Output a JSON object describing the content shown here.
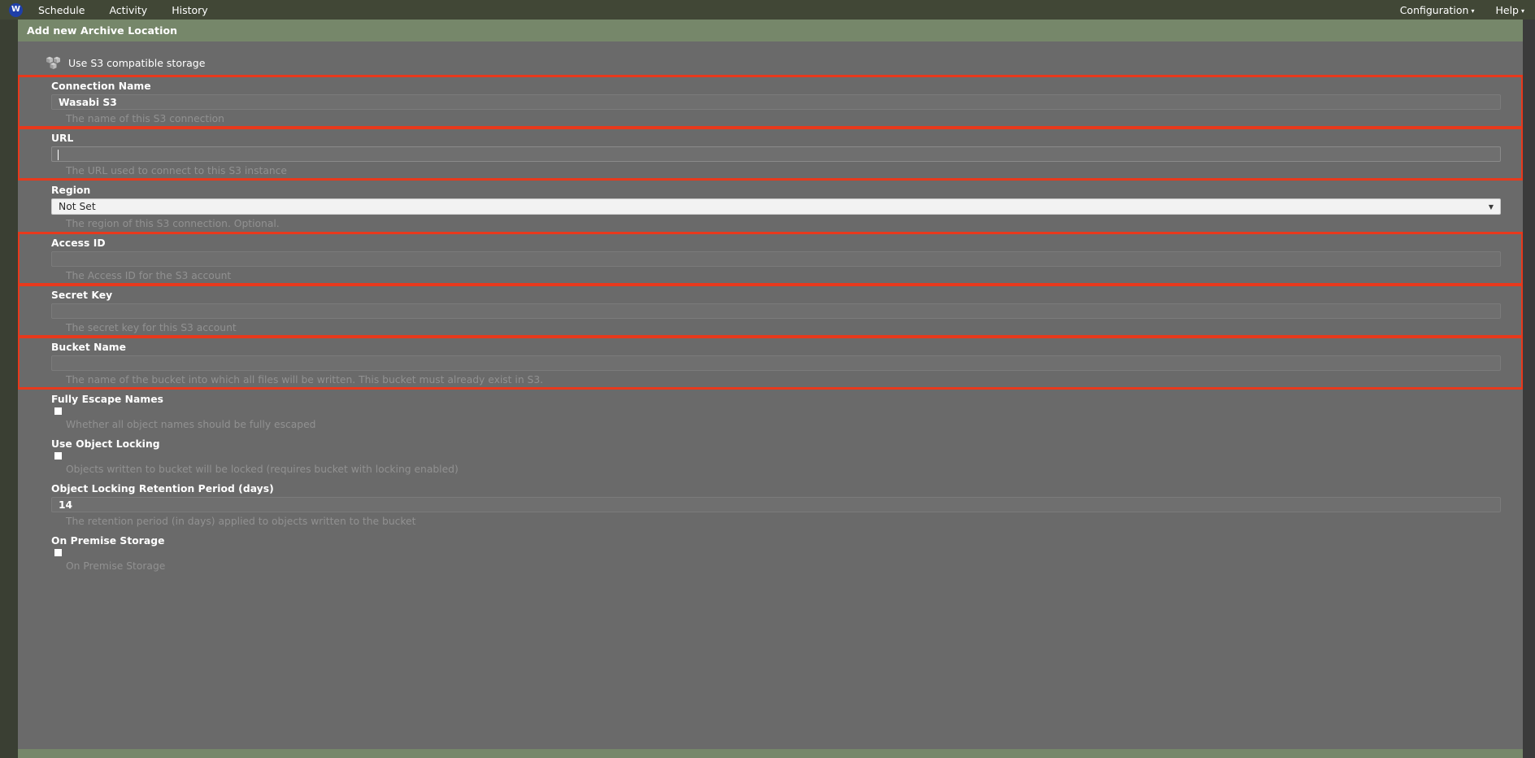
{
  "topbar": {
    "logo": "W",
    "logo_icon": "app-logo-icon",
    "left_items": [
      {
        "label": "Schedule",
        "name": "nav-schedule"
      },
      {
        "label": "Activity",
        "name": "nav-activity"
      },
      {
        "label": "History",
        "name": "nav-history"
      }
    ],
    "right_items": [
      {
        "label": "Configuration",
        "caret": "▾",
        "name": "nav-configuration"
      },
      {
        "label": "Help",
        "caret": "▾",
        "name": "nav-help"
      }
    ]
  },
  "page": {
    "title": "Add new Archive Location",
    "storage_type_label": "Use S3 compatible storage",
    "storage_icon": "s3-bucket-icon"
  },
  "form": {
    "fields": [
      {
        "id": "connection-name",
        "label": "Connection Name",
        "type": "text",
        "value": "Wasabi S3",
        "placeholder": "",
        "help": "The name of this S3 connection",
        "highlighted": true
      },
      {
        "id": "url",
        "label": "URL",
        "type": "text",
        "value": "",
        "placeholder": "",
        "help": "The URL used to connect to this S3 instance",
        "highlighted": true,
        "focused": true
      },
      {
        "id": "region",
        "label": "Region",
        "type": "select",
        "value": "Not Set",
        "options": [
          "Not Set"
        ],
        "help": "The region of this S3 connection. Optional.",
        "highlighted": false
      },
      {
        "id": "access-id",
        "label": "Access ID",
        "type": "text",
        "value": "",
        "placeholder": "",
        "help": "The Access ID for the S3 account",
        "highlighted": true
      },
      {
        "id": "secret-key",
        "label": "Secret Key",
        "type": "password",
        "value": "",
        "placeholder": "",
        "help": "The secret key for this S3 account",
        "highlighted": true
      },
      {
        "id": "bucket-name",
        "label": "Bucket Name",
        "type": "text",
        "value": "",
        "placeholder": "",
        "help": "The name of the bucket into which all files will be written. This bucket must already exist in S3.",
        "highlighted": true
      },
      {
        "id": "fully-escape-names",
        "label": "Fully Escape Names",
        "type": "checkbox",
        "checked": false,
        "help": "Whether all object names should be fully escaped",
        "highlighted": false
      },
      {
        "id": "use-object-locking",
        "label": "Use Object Locking",
        "type": "checkbox",
        "checked": false,
        "help": "Objects written to bucket will be locked (requires bucket with locking enabled)",
        "highlighted": false
      },
      {
        "id": "object-locking-retention-period",
        "label": "Object Locking Retention Period (days)",
        "type": "text",
        "value": "14",
        "placeholder": "",
        "help": "The retention period (in days) applied to objects written to the bucket",
        "highlighted": false
      },
      {
        "id": "on-premise-storage",
        "label": "On Premise Storage",
        "type": "checkbox",
        "checked": false,
        "help": "On Premise Storage",
        "highlighted": false
      }
    ]
  },
  "colors": {
    "nav_background": "#414736",
    "header_green": "#76876a",
    "content_background": "#6a6a6a",
    "highlight_red": "#e8391c",
    "logo_blue": "#1f3fa8",
    "help_text": "#919191"
  }
}
